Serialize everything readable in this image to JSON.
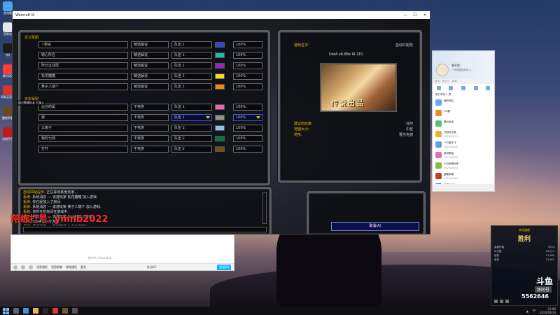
{
  "window": {
    "title": "Warcraft III",
    "min": "—",
    "max": "☐",
    "close": "✕"
  },
  "desktop_icons": [
    {
      "label": "此电脑",
      "color": "#4aa3f0"
    },
    {
      "label": "回收站",
      "color": "#e6e6e6"
    },
    {
      "label": "QQ",
      "color": "#1b1b1b"
    },
    {
      "label": "腾讯QQ",
      "color": "#ff3a3a"
    },
    {
      "label": "网易云音乐",
      "color": "#e0302c"
    },
    {
      "label": "魔兽争霸",
      "color": "#6a4a22"
    },
    {
      "label": "对战平台",
      "color": "#c21a1a"
    }
  ],
  "lobby": {
    "team1_label": "近卫军团",
    "team2_label": "天灾军团",
    "team1": [
      {
        "player": "↑新名",
        "type": "精选解说",
        "team": "队伍 1",
        "color": "#2a4bd8",
        "handicap": "100%"
      },
      {
        "player": "嗯心所在",
        "type": "精选解说",
        "team": "队伍 1",
        "color": "#20b8b0",
        "handicap": "100%"
      },
      {
        "player": "昨日过往斑",
        "type": "精选解说",
        "team": "队伍 1",
        "color": "#a020c8",
        "handicap": "100%"
      },
      {
        "player": "松花糖糖",
        "type": "精选解说",
        "team": "队伍 1",
        "color": "#f0e020",
        "handicap": "100%"
      },
      {
        "player": "黄子人端个",
        "type": "精选解说",
        "team": "队伍 1",
        "color": "#f08a10",
        "handicap": "100%"
      }
    ],
    "team2": [
      {
        "player": "蓝丝的黑",
        "type": "不死族",
        "team": "队伍 1",
        "color": "#f060b0",
        "handicap": "100%",
        "selected": false
      },
      {
        "player": "我",
        "type": "不死族",
        "team": "队伍 1",
        "color": "#909090",
        "handicap": "100%",
        "selected": true
      },
      {
        "player": "三雨子",
        "type": "不死族",
        "team": "队伍 2",
        "color": "#90c0f0",
        "handicap": "100%",
        "selected": false
      },
      {
        "player": "我的七妹",
        "type": "不死族",
        "team": "队伍 2",
        "color": "#107040",
        "handicap": "100%",
        "selected": false
      },
      {
        "player": "打开",
        "type": "不死族",
        "team": "队伍 2",
        "color": "#705020",
        "handicap": "100%",
        "selected": false
      }
    ],
    "overlay_tooltip": "自己邀请队友 已加入"
  },
  "map_info": {
    "game_name_label": "游戏名字:",
    "auto_label": "自动匹配局",
    "version": "DotA v6.88e IR 1E1",
    "map_banner": "传说出品",
    "suggested_label": "建议的玩家:",
    "suggested_value": "任何",
    "map_size_label": "地图大小:",
    "map_size_value": "中型",
    "author_label": "地形:",
    "author_value": "曹尔克德"
  },
  "chat": [
    {
      "who": "自动匹配提示:",
      "text": "正在等待其他玩家..."
    },
    {
      "who": "系统:",
      "text": "系统消息  ---  该游玩家 松花糖糖 加入游戏."
    },
    {
      "who": "系统:",
      "text": "你已经加入了房间."
    },
    {
      "who": "系统:",
      "text": "系统消息  ---  该游玩家 黄子人端个 加入游戏."
    },
    {
      "who": "系统:",
      "text": "你所在的房间在游戏中."
    },
    {
      "who": "系统:",
      "text": "系统消息  ---  该游玩家 fool# 加入游戏."
    },
    {
      "who": "系统:",
      "text": "fool#加入了游戏."
    },
    {
      "who": "系统:",
      "text": "系统消息  ---  游戏等待 1 个玩家加入"
    }
  ],
  "cancel_label": "取消(A)",
  "streamer_watermark": "陪练打号: ymnb2022",
  "qq_chat": {
    "placeholder": "按Ctrl+Enter发送...",
    "tools": [
      "表情",
      "截图",
      "文件"
    ],
    "tool_labels": [
      "语音通话",
      "语音群聊",
      "视频通话",
      "更多"
    ],
    "send_label": "发送(S)",
    "close_label": "关闭(C)"
  },
  "side_panel": {
    "name": "我不是",
    "sub": "一份孤独的老年人~",
    "search_placeholder": "搜索：联系人、群聊",
    "tabs": "消息  联系人  群",
    "items": [
      {
        "title": "我的好友",
        "sub": "",
        "color": "#6aa8f0"
      },
      {
        "title": "QQ群",
        "sub": "",
        "color": "#f08a30"
      },
      {
        "title": "最近会话",
        "sub": "",
        "color": "#58c070"
      },
      {
        "title": "只因你太美",
        "sub": "2023/09/11",
        "color": "#f0b030"
      },
      {
        "title": "一只猫不飞",
        "sub": "2023/08/20",
        "color": "#60a0e0"
      },
      {
        "title": "游戏群组",
        "sub": "2023/08/16",
        "color": "#e070b0"
      },
      {
        "title": "小白来看世界",
        "sub": "2023/08/15",
        "color": "#80c040"
      },
      {
        "title": "魔兽争霸",
        "sub": "2023/08/10",
        "color": "#c04030"
      },
      {
        "title": "刀塔DOTA",
        "sub": "2023/08/01",
        "color": "#3060c0"
      }
    ]
  },
  "douyu": {
    "title": "本场战绩",
    "result": "胜利",
    "stats": [
      {
        "k": "英雄伤害",
        "v": "5/0/4"
      },
      {
        "k": "补刀数",
        "v": "201/17"
      },
      {
        "k": "经验",
        "v": "21,484"
      },
      {
        "k": "金钱",
        "v": "21,641"
      }
    ],
    "logo": "斗鱼",
    "room_label": "房间号",
    "room_no": "5562646"
  },
  "taskbar": {
    "time": "23:06",
    "date": "2023/09/24",
    "lang": "中"
  }
}
